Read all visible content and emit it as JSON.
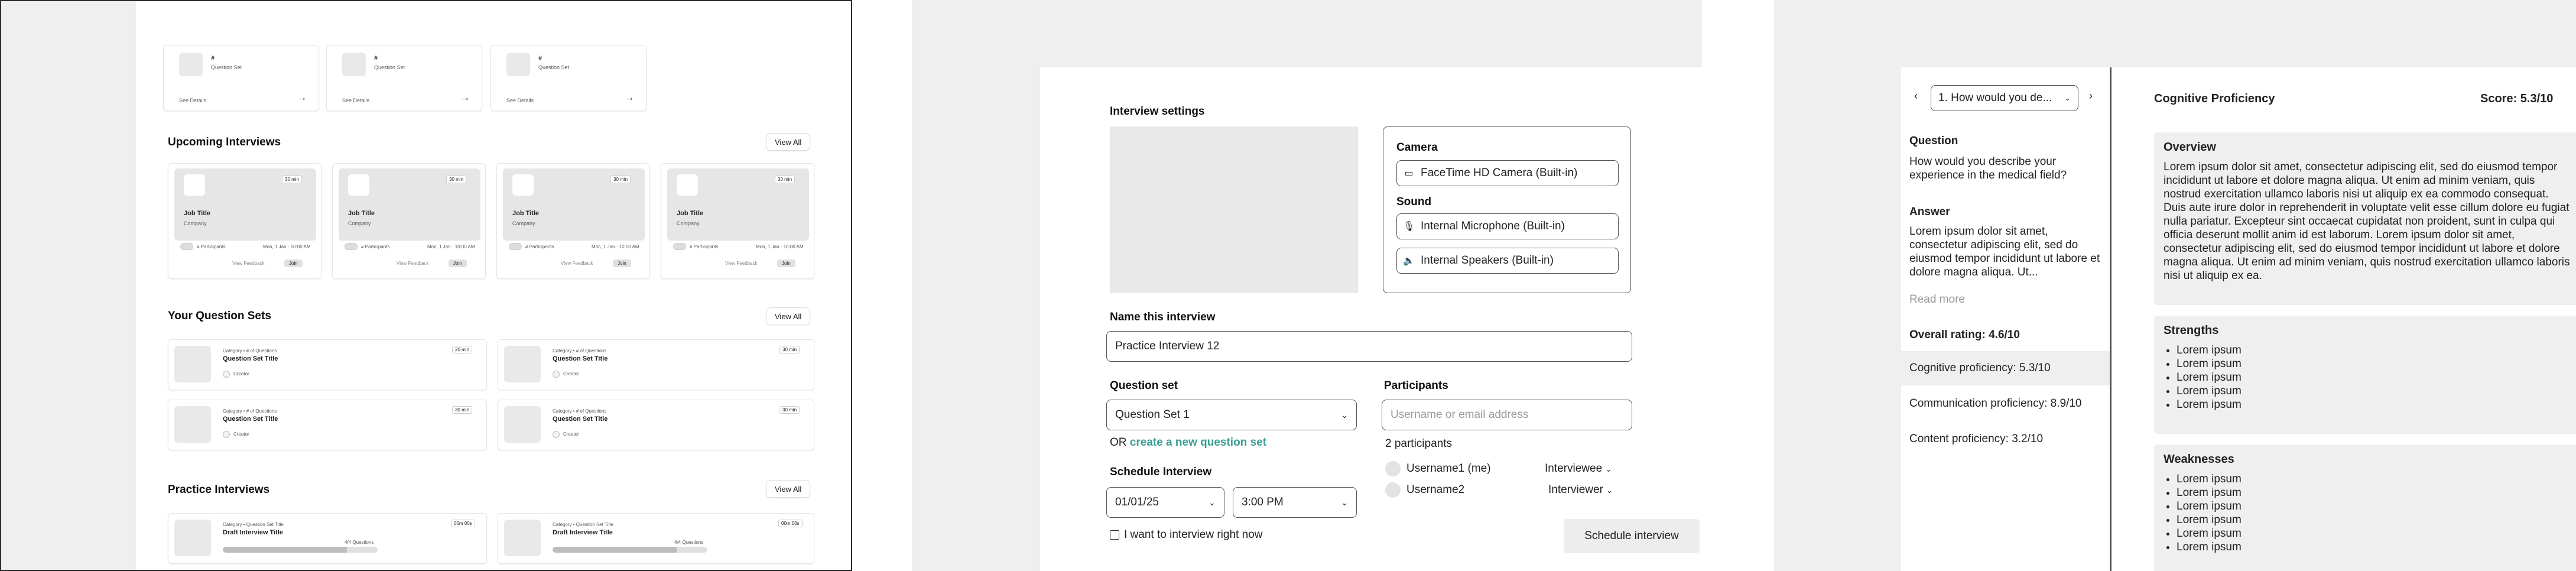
{
  "dashboard": {
    "top_cards": [
      {
        "icon": "#",
        "label": "Question Set",
        "details": "See Details"
      },
      {
        "icon": "#",
        "label": "Question Set",
        "details": "See Details"
      },
      {
        "icon": "#",
        "label": "Question Set",
        "details": "See Details"
      }
    ],
    "upcoming": {
      "title": "Upcoming Interviews",
      "view_all": "View All",
      "cards": [
        {
          "duration": "30 min",
          "job_title": "Job Title",
          "company": "Company",
          "participants": "# Participants",
          "datetime": "Mon, 1 Jan · 10:00 AM",
          "feedback": "View Feedback",
          "join": "Join"
        },
        {
          "duration": "30 min",
          "job_title": "Job Title",
          "company": "Company",
          "participants": "# Participants",
          "datetime": "Mon, 1 Jan · 10:00 AM",
          "feedback": "View Feedback",
          "join": "Join"
        },
        {
          "duration": "30 min",
          "job_title": "Job Title",
          "company": "Company",
          "participants": "# Participants",
          "datetime": "Mon, 1 Jan · 10:00 AM",
          "feedback": "View Feedback",
          "join": "Join"
        },
        {
          "duration": "30 min",
          "job_title": "Job Title",
          "company": "Company",
          "participants": "# Participants",
          "datetime": "Mon, 1 Jan · 10:00 AM",
          "feedback": "View Feedback",
          "join": "Join"
        }
      ]
    },
    "question_sets": {
      "title": "Your Question Sets",
      "view_all": "View All",
      "cards": [
        {
          "meta": "Category • # of Questions",
          "title": "Question Set Title",
          "creator": "Creator",
          "duration": "20 min"
        },
        {
          "meta": "Category • # of Questions",
          "title": "Question Set Title",
          "creator": "Creator",
          "duration": "30 min"
        },
        {
          "meta": "Category • # of Questions",
          "title": "Question Set Title",
          "creator": "Creator",
          "duration": "30 min"
        },
        {
          "meta": "Category • # of Questions",
          "title": "Question Set Title",
          "creator": "Creator",
          "duration": "30 min"
        }
      ]
    },
    "practice": {
      "title": "Practice Interviews",
      "view_all": "View All",
      "cards": [
        {
          "meta": "Category • Question Set Title",
          "title": "Draft Interview Title",
          "time": "00m 00s",
          "progress_text": "4/4 Questions",
          "progress": 0.8
        },
        {
          "meta": "Category • Question Set Title",
          "title": "Draft Interview Title",
          "time": "00m 00s",
          "progress_text": "4/4 Questions",
          "progress": 0.8
        }
      ]
    }
  },
  "settings": {
    "header": "Interview settings",
    "camera_label": "Camera",
    "camera_device": "FaceTime HD Camera (Built-in)",
    "sound_label": "Sound",
    "mic_device": "Internal Microphone (Built-in)",
    "speaker_device": "Internal Speakers (Built-in)",
    "name_label": "Name this interview",
    "name_value": "Practice Interview 12",
    "qset_label": "Question set",
    "qset_value": "Question Set 1",
    "or_text": "OR",
    "create_link": "create a new question set",
    "schedule_label": "Schedule Interview",
    "date_value": "01/01/25",
    "time_value": "3:00 PM",
    "now_checkbox": "I want to interview right now",
    "participants_label": "Participants",
    "participants_placeholder": "Username or email address",
    "participants_count": "2 participants",
    "participants": [
      {
        "name": "Username1 (me)",
        "role": "Interviewee"
      },
      {
        "name": "Username2",
        "role": "Interviewer"
      }
    ],
    "schedule_button": "Schedule interview",
    "link_color": "#3a9e93"
  },
  "feedback": {
    "question_select": "1. How would you de...",
    "question_label": "Question",
    "question_text": "How would you describe your experience in the medical field?",
    "answer_label": "Answer",
    "answer_text": "Lorem ipsum dolor sit amet, consectetur adipiscing elit, sed do eiusmod tempor incididunt ut labore et dolore magna aliqua. Ut...",
    "read_more": "Read more",
    "overall_rating": "Overall rating: 4.6/10",
    "scores": [
      {
        "label": "Cognitive proficiency: 5.3/10",
        "selected": true
      },
      {
        "label": "Communication proficiency: 8.9/10",
        "selected": false
      },
      {
        "label": "Content proficiency: 3.2/10",
        "selected": false
      }
    ],
    "right_title": "Cognitive Proficiency",
    "right_score": "Score: 5.3/10",
    "overview_title": "Overview",
    "overview_text": "Lorem ipsum dolor sit amet, consectetur adipiscing elit, sed do eiusmod tempor incididunt ut labore et dolore magna aliqua. Ut enim ad minim veniam, quis nostrud exercitation ullamco laboris nisi ut aliquip ex ea commodo consequat. Duis aute irure dolor in reprehenderit in voluptate velit esse cillum dolore eu fugiat nulla pariatur. Excepteur sint occaecat cupidatat non proident, sunt in culpa qui officia deserunt mollit anim id est laborum. Lorem ipsum dolor sit amet, consectetur adipiscing elit, sed do eiusmod tempor incididunt ut labore et dolore magna aliqua. Ut enim ad minim veniam, quis nostrud exercitation ullamco laboris nisi ut aliquip ex ea.",
    "strengths_title": "Strengths",
    "strengths": [
      "Lorem ipsum",
      "Lorem ipsum",
      "Lorem ipsum",
      "Lorem ipsum",
      "Lorem ipsum"
    ],
    "weaknesses_title": "Weaknesses",
    "weaknesses": [
      "Lorem ipsum",
      "Lorem ipsum",
      "Lorem ipsum",
      "Lorem ipsum",
      "Lorem ipsum",
      "Lorem ipsum"
    ]
  }
}
